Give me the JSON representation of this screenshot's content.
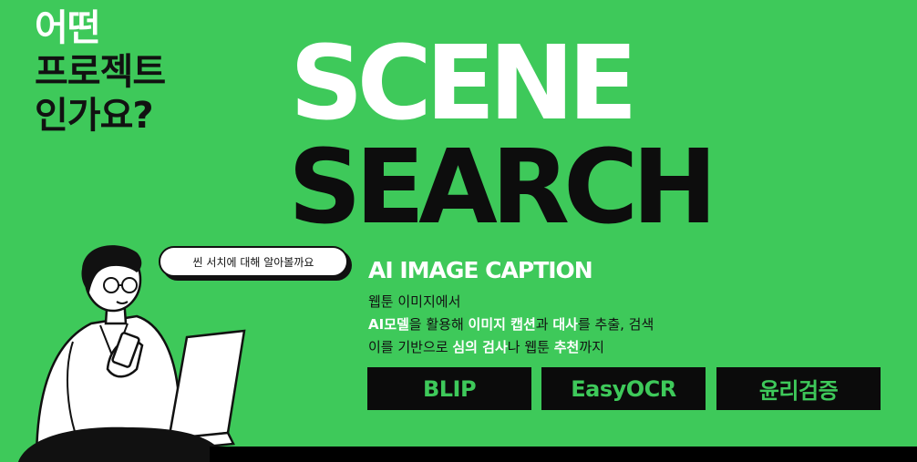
{
  "question": {
    "line1": "어떤",
    "line2": "프로젝트",
    "line3": "인가요?"
  },
  "title": {
    "line1": "SCENE",
    "line2": "SEARCH"
  },
  "speech_bubble": "씬 서치에 대해 알아볼까요",
  "caption_title": "AI IMAGE CAPTION",
  "description": {
    "line1": "웹툰 이미지에서",
    "line2": [
      {
        "text": "AI모델",
        "highlight": true
      },
      {
        "text": "을 활용해 ",
        "highlight": false
      },
      {
        "text": "이미지 캡션",
        "highlight": true
      },
      {
        "text": "과 ",
        "highlight": false
      },
      {
        "text": "대사",
        "highlight": true
      },
      {
        "text": "를 추출, 검색",
        "highlight": false
      }
    ],
    "line3": [
      {
        "text": "이를 기반으로 ",
        "highlight": false
      },
      {
        "text": "심의 검사",
        "highlight": true
      },
      {
        "text": "나 웹툰 ",
        "highlight": false
      },
      {
        "text": "추천",
        "highlight": true
      },
      {
        "text": "까지",
        "highlight": false
      }
    ]
  },
  "tags": [
    "BLIP",
    "EasyOCR",
    "윤리검증"
  ],
  "colors": {
    "background": "#3ec95a",
    "dark": "#0b0b0b",
    "white": "#ffffff"
  },
  "illustration": "man-with-laptop-and-phone"
}
